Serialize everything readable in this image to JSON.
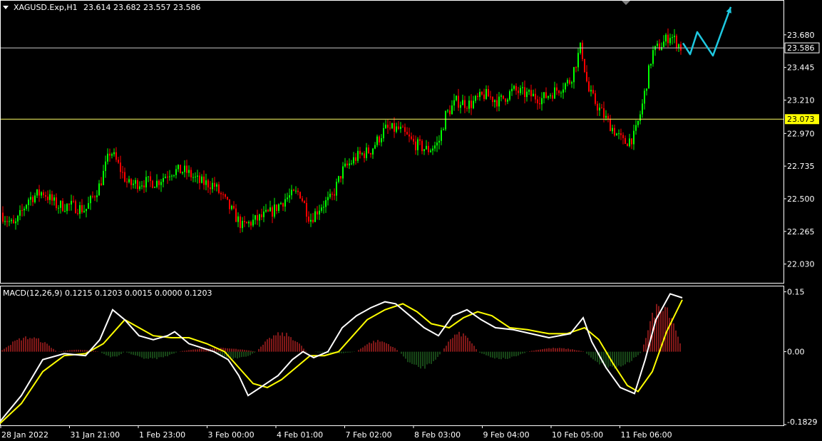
{
  "header": {
    "symbol": "XAGUSD.Exp,H1",
    "ohlc": "23.614 23.682 23.557 23.586"
  },
  "macd_header": "MACD(12,26,9) 0.1215 0.1203 0.0015 0.0000 0.1203",
  "colors": {
    "background": "#000000",
    "bull": "#00ff00",
    "bear": "#ff0000",
    "macd_line": "#ffffff",
    "signal_line": "#ffff00",
    "hist_pos": "#ff3030",
    "hist_neg": "#2e8b2e",
    "arrow": "#1ec8e0",
    "bid_line": "#c8c8c8",
    "level_line": "#ffff66",
    "level_badge": "#ffff00"
  },
  "chart_data": [
    {
      "type": "candlestick",
      "title": "XAGUSD.Exp,H1",
      "y_ticks": [
        "23.680",
        "23.445",
        "23.210",
        "22.970",
        "22.735",
        "22.500",
        "22.265",
        "22.030"
      ],
      "ylim": [
        21.9,
        23.91
      ],
      "current_price": "23.586",
      "horizontal_level": "23.073",
      "x_labels": [
        "28 Jan 2022",
        "31 Jan 21:00",
        "1 Feb 23:00",
        "3 Feb 00:00",
        "4 Feb 01:00",
        "7 Feb 02:00",
        "8 Feb 03:00",
        "9 Feb 04:00",
        "10 Feb 05:00",
        "11 Feb 06:00"
      ],
      "close_path": [
        [
          0,
          22.4
        ],
        [
          20,
          22.3
        ],
        [
          40,
          22.5
        ],
        [
          60,
          22.55
        ],
        [
          80,
          22.45
        ],
        [
          100,
          22.45
        ],
        [
          120,
          22.42
        ],
        [
          140,
          22.6
        ],
        [
          155,
          22.85
        ],
        [
          165,
          22.75
        ],
        [
          180,
          22.6
        ],
        [
          200,
          22.62
        ],
        [
          220,
          22.62
        ],
        [
          240,
          22.7
        ],
        [
          260,
          22.7
        ],
        [
          280,
          22.62
        ],
        [
          300,
          22.6
        ],
        [
          320,
          22.45
        ],
        [
          340,
          22.3
        ],
        [
          360,
          22.35
        ],
        [
          380,
          22.4
        ],
        [
          400,
          22.5
        ],
        [
          420,
          22.55
        ],
        [
          435,
          22.35
        ],
        [
          450,
          22.45
        ],
        [
          465,
          22.5
        ],
        [
          480,
          22.7
        ],
        [
          500,
          22.8
        ],
        [
          520,
          22.85
        ],
        [
          540,
          23.0
        ],
        [
          560,
          23.0
        ],
        [
          580,
          22.9
        ],
        [
          600,
          22.85
        ],
        [
          615,
          22.9
        ],
        [
          625,
          23.1
        ],
        [
          640,
          23.2
        ],
        [
          660,
          23.18
        ],
        [
          680,
          23.25
        ],
        [
          700,
          23.2
        ],
        [
          720,
          23.28
        ],
        [
          740,
          23.25
        ],
        [
          760,
          23.22
        ],
        [
          780,
          23.28
        ],
        [
          800,
          23.35
        ],
        [
          815,
          23.6
        ],
        [
          825,
          23.28
        ],
        [
          840,
          23.15
        ],
        [
          860,
          23.0
        ],
        [
          875,
          22.9
        ],
        [
          890,
          22.95
        ],
        [
          900,
          23.15
        ],
        [
          915,
          23.55
        ],
        [
          930,
          23.62
        ],
        [
          940,
          23.68
        ],
        [
          955,
          23.59
        ]
      ],
      "forecast_arrows": [
        [
          [
            958,
            23.62
          ],
          [
            968,
            23.54
          ],
          [
            978,
            23.7
          ],
          [
            1000,
            23.53
          ],
          [
            1025,
            23.88
          ]
        ]
      ]
    },
    {
      "type": "macd",
      "title": "MACD(12,26,9)",
      "y_ticks": [
        "0.15",
        "0.00",
        "-0.1829"
      ],
      "ylim": [
        -0.1829,
        0.16
      ],
      "macd": [
        [
          0,
          -0.175
        ],
        [
          30,
          -0.11
        ],
        [
          60,
          -0.02
        ],
        [
          90,
          -0.005
        ],
        [
          120,
          -0.01
        ],
        [
          140,
          0.03
        ],
        [
          158,
          0.105
        ],
        [
          175,
          0.08
        ],
        [
          195,
          0.04
        ],
        [
          215,
          0.03
        ],
        [
          235,
          0.04
        ],
        [
          245,
          0.05
        ],
        [
          265,
          0.02
        ],
        [
          300,
          0.0
        ],
        [
          320,
          -0.02
        ],
        [
          335,
          -0.06
        ],
        [
          348,
          -0.11
        ],
        [
          365,
          -0.09
        ],
        [
          390,
          -0.06
        ],
        [
          410,
          -0.02
        ],
        [
          425,
          0.0
        ],
        [
          440,
          -0.015
        ],
        [
          460,
          0.0
        ],
        [
          480,
          0.06
        ],
        [
          500,
          0.09
        ],
        [
          520,
          0.11
        ],
        [
          540,
          0.125
        ],
        [
          555,
          0.12
        ],
        [
          575,
          0.09
        ],
        [
          595,
          0.06
        ],
        [
          615,
          0.04
        ],
        [
          635,
          0.09
        ],
        [
          655,
          0.105
        ],
        [
          675,
          0.08
        ],
        [
          695,
          0.06
        ],
        [
          720,
          0.055
        ],
        [
          745,
          0.045
        ],
        [
          770,
          0.035
        ],
        [
          800,
          0.045
        ],
        [
          818,
          0.085
        ],
        [
          830,
          0.025
        ],
        [
          850,
          -0.04
        ],
        [
          870,
          -0.09
        ],
        [
          890,
          -0.105
        ],
        [
          905,
          -0.02
        ],
        [
          920,
          0.08
        ],
        [
          940,
          0.145
        ],
        [
          957,
          0.135
        ]
      ],
      "signal": [
        [
          0,
          -0.18
        ],
        [
          30,
          -0.13
        ],
        [
          60,
          -0.05
        ],
        [
          90,
          -0.01
        ],
        [
          120,
          -0.005
        ],
        [
          145,
          0.02
        ],
        [
          175,
          0.08
        ],
        [
          195,
          0.06
        ],
        [
          215,
          0.04
        ],
        [
          240,
          0.035
        ],
        [
          265,
          0.035
        ],
        [
          290,
          0.02
        ],
        [
          315,
          0.0
        ],
        [
          335,
          -0.04
        ],
        [
          355,
          -0.08
        ],
        [
          375,
          -0.09
        ],
        [
          395,
          -0.07
        ],
        [
          415,
          -0.04
        ],
        [
          435,
          -0.01
        ],
        [
          455,
          -0.01
        ],
        [
          475,
          0.0
        ],
        [
          495,
          0.04
        ],
        [
          515,
          0.08
        ],
        [
          540,
          0.105
        ],
        [
          565,
          0.12
        ],
        [
          585,
          0.1
        ],
        [
          605,
          0.07
        ],
        [
          630,
          0.06
        ],
        [
          650,
          0.085
        ],
        [
          670,
          0.1
        ],
        [
          690,
          0.09
        ],
        [
          715,
          0.06
        ],
        [
          740,
          0.055
        ],
        [
          770,
          0.045
        ],
        [
          795,
          0.045
        ],
        [
          820,
          0.06
        ],
        [
          840,
          0.03
        ],
        [
          860,
          -0.03
        ],
        [
          880,
          -0.085
        ],
        [
          895,
          -0.1
        ],
        [
          915,
          -0.05
        ],
        [
          935,
          0.05
        ],
        [
          957,
          0.13
        ]
      ],
      "histogram_bumps": [
        [
          0,
          80,
          0.04
        ],
        [
          80,
          140,
          0.005
        ],
        [
          140,
          175,
          -0.015
        ],
        [
          175,
          250,
          -0.02
        ],
        [
          250,
          360,
          0.01
        ],
        [
          300,
          360,
          -0.02
        ],
        [
          360,
          430,
          0.05
        ],
        [
          440,
          500,
          -0.005
        ],
        [
          500,
          560,
          0.03
        ],
        [
          560,
          620,
          -0.045
        ],
        [
          620,
          670,
          0.05
        ],
        [
          670,
          740,
          -0.02
        ],
        [
          740,
          820,
          0.01
        ],
        [
          820,
          900,
          -0.045
        ],
        [
          900,
          957,
          0.135
        ]
      ]
    }
  ]
}
